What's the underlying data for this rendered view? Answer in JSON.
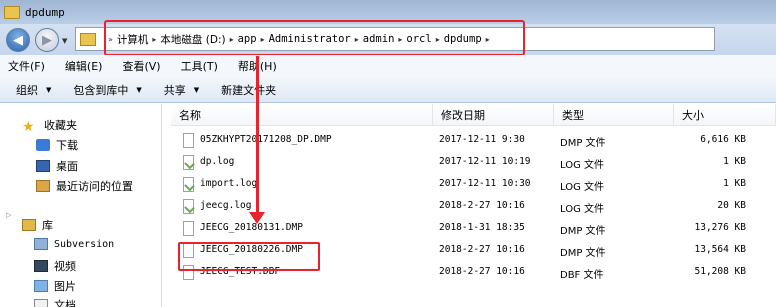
{
  "window": {
    "title": "dpdump"
  },
  "address": {
    "crumbs": [
      {
        "label": "计算机",
        "mono": false
      },
      {
        "label": "本地磁盘 (D:)",
        "mono": false
      },
      {
        "label": "app",
        "mono": true
      },
      {
        "label": "Administrator",
        "mono": true
      },
      {
        "label": "admin",
        "mono": true
      },
      {
        "label": "orcl",
        "mono": true
      },
      {
        "label": "dpdump",
        "mono": true
      }
    ]
  },
  "menu": [
    "文件(F)",
    "编辑(E)",
    "查看(V)",
    "工具(T)",
    "帮助(H)"
  ],
  "toolbar": {
    "organize": "组织",
    "include_library": "包含到库中",
    "share": "共享",
    "new_folder": "新建文件夹"
  },
  "sidebar": {
    "favorites": "收藏夹",
    "downloads": "下载",
    "desktop": "桌面",
    "recent": "最近访问的位置",
    "libraries": "库",
    "subversion": "Subversion",
    "videos": "视频",
    "pictures": "图片",
    "documents": "文档"
  },
  "columns": {
    "name": "名称",
    "date": "修改日期",
    "type": "类型",
    "size": "大小"
  },
  "files": [
    {
      "name": "05ZKHYPT20171208_DP.DMP",
      "date": "2017-12-11 9:30",
      "type": "DMP 文件",
      "size": "6,616 KB",
      "icon": "dmp"
    },
    {
      "name": "dp.log",
      "date": "2017-12-11 10:19",
      "type": "LOG 文件",
      "size": "1 KB",
      "icon": "log"
    },
    {
      "name": "import.log",
      "date": "2017-12-11 10:30",
      "type": "LOG 文件",
      "size": "1 KB",
      "icon": "log"
    },
    {
      "name": "jeecg.log",
      "date": "2018-2-27 10:16",
      "type": "LOG 文件",
      "size": "20 KB",
      "icon": "log"
    },
    {
      "name": "JEECG_20180131.DMP",
      "date": "2018-1-31 18:35",
      "type": "DMP 文件",
      "size": "13,276 KB",
      "icon": "dmp"
    },
    {
      "name": "JEECG_20180226.DMP",
      "date": "2018-2-27 10:16",
      "type": "DMP 文件",
      "size": "13,564 KB",
      "icon": "dmp"
    },
    {
      "name": "JEECG_TEST.DBF",
      "date": "2018-2-27 10:16",
      "type": "DBF 文件",
      "size": "51,208 KB",
      "icon": "dbf"
    }
  ],
  "colors": {
    "annotation_red": "#e8232b",
    "titlebar": "#b9cde6"
  }
}
